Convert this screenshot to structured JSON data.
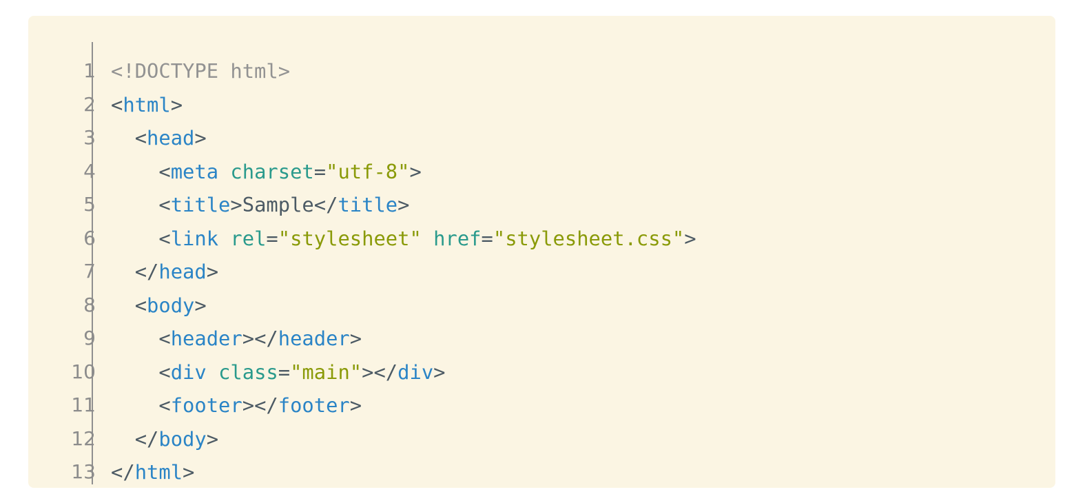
{
  "code": {
    "line_numbers": [
      "1",
      "2",
      "3",
      "4",
      "5",
      "6",
      "7",
      "8",
      "9",
      "10",
      "11",
      "12",
      "13"
    ],
    "lines": [
      [
        {
          "t": "doctype",
          "v": "<!DOCTYPE html>"
        }
      ],
      [
        {
          "t": "punct",
          "v": "<"
        },
        {
          "t": "tag",
          "v": "html"
        },
        {
          "t": "punct",
          "v": ">"
        }
      ],
      [
        {
          "t": "text",
          "v": "  "
        },
        {
          "t": "punct",
          "v": "<"
        },
        {
          "t": "tag",
          "v": "head"
        },
        {
          "t": "punct",
          "v": ">"
        }
      ],
      [
        {
          "t": "text",
          "v": "    "
        },
        {
          "t": "punct",
          "v": "<"
        },
        {
          "t": "tag",
          "v": "meta"
        },
        {
          "t": "text",
          "v": " "
        },
        {
          "t": "attr",
          "v": "charset"
        },
        {
          "t": "punct",
          "v": "="
        },
        {
          "t": "str",
          "v": "\"utf-8\""
        },
        {
          "t": "punct",
          "v": ">"
        }
      ],
      [
        {
          "t": "text",
          "v": "    "
        },
        {
          "t": "punct",
          "v": "<"
        },
        {
          "t": "tag",
          "v": "title"
        },
        {
          "t": "punct",
          "v": ">"
        },
        {
          "t": "text",
          "v": "Sample"
        },
        {
          "t": "punct",
          "v": "</"
        },
        {
          "t": "tag",
          "v": "title"
        },
        {
          "t": "punct",
          "v": ">"
        }
      ],
      [
        {
          "t": "text",
          "v": "    "
        },
        {
          "t": "punct",
          "v": "<"
        },
        {
          "t": "tag",
          "v": "link"
        },
        {
          "t": "text",
          "v": " "
        },
        {
          "t": "attr",
          "v": "rel"
        },
        {
          "t": "punct",
          "v": "="
        },
        {
          "t": "str",
          "v": "\"stylesheet\""
        },
        {
          "t": "text",
          "v": " "
        },
        {
          "t": "attr",
          "v": "href"
        },
        {
          "t": "punct",
          "v": "="
        },
        {
          "t": "str",
          "v": "\"stylesheet.css\""
        },
        {
          "t": "punct",
          "v": ">"
        }
      ],
      [
        {
          "t": "text",
          "v": "  "
        },
        {
          "t": "punct",
          "v": "</"
        },
        {
          "t": "tag",
          "v": "head"
        },
        {
          "t": "punct",
          "v": ">"
        }
      ],
      [
        {
          "t": "text",
          "v": "  "
        },
        {
          "t": "punct",
          "v": "<"
        },
        {
          "t": "tag",
          "v": "body"
        },
        {
          "t": "punct",
          "v": ">"
        }
      ],
      [
        {
          "t": "text",
          "v": "    "
        },
        {
          "t": "punct",
          "v": "<"
        },
        {
          "t": "tag",
          "v": "header"
        },
        {
          "t": "punct",
          "v": "></"
        },
        {
          "t": "tag",
          "v": "header"
        },
        {
          "t": "punct",
          "v": ">"
        }
      ],
      [
        {
          "t": "text",
          "v": "    "
        },
        {
          "t": "punct",
          "v": "<"
        },
        {
          "t": "tag",
          "v": "div"
        },
        {
          "t": "text",
          "v": " "
        },
        {
          "t": "attr",
          "v": "class"
        },
        {
          "t": "punct",
          "v": "="
        },
        {
          "t": "str",
          "v": "\"main\""
        },
        {
          "t": "punct",
          "v": "></"
        },
        {
          "t": "tag",
          "v": "div"
        },
        {
          "t": "punct",
          "v": ">"
        }
      ],
      [
        {
          "t": "text",
          "v": "    "
        },
        {
          "t": "punct",
          "v": "<"
        },
        {
          "t": "tag",
          "v": "footer"
        },
        {
          "t": "punct",
          "v": "></"
        },
        {
          "t": "tag",
          "v": "footer"
        },
        {
          "t": "punct",
          "v": ">"
        }
      ],
      [
        {
          "t": "text",
          "v": "  "
        },
        {
          "t": "punct",
          "v": "</"
        },
        {
          "t": "tag",
          "v": "body"
        },
        {
          "t": "punct",
          "v": ">"
        }
      ],
      [
        {
          "t": "punct",
          "v": "</"
        },
        {
          "t": "tag",
          "v": "html"
        },
        {
          "t": "punct",
          "v": ">"
        }
      ]
    ]
  },
  "colors": {
    "panel_background": "#fbf5e3",
    "line_number": "#8c8c8c",
    "doctype": "#929292",
    "punctuation": "#4c5a64",
    "tag_name": "#2a84c6",
    "attribute": "#2a9a8c",
    "string": "#8a9a08"
  }
}
